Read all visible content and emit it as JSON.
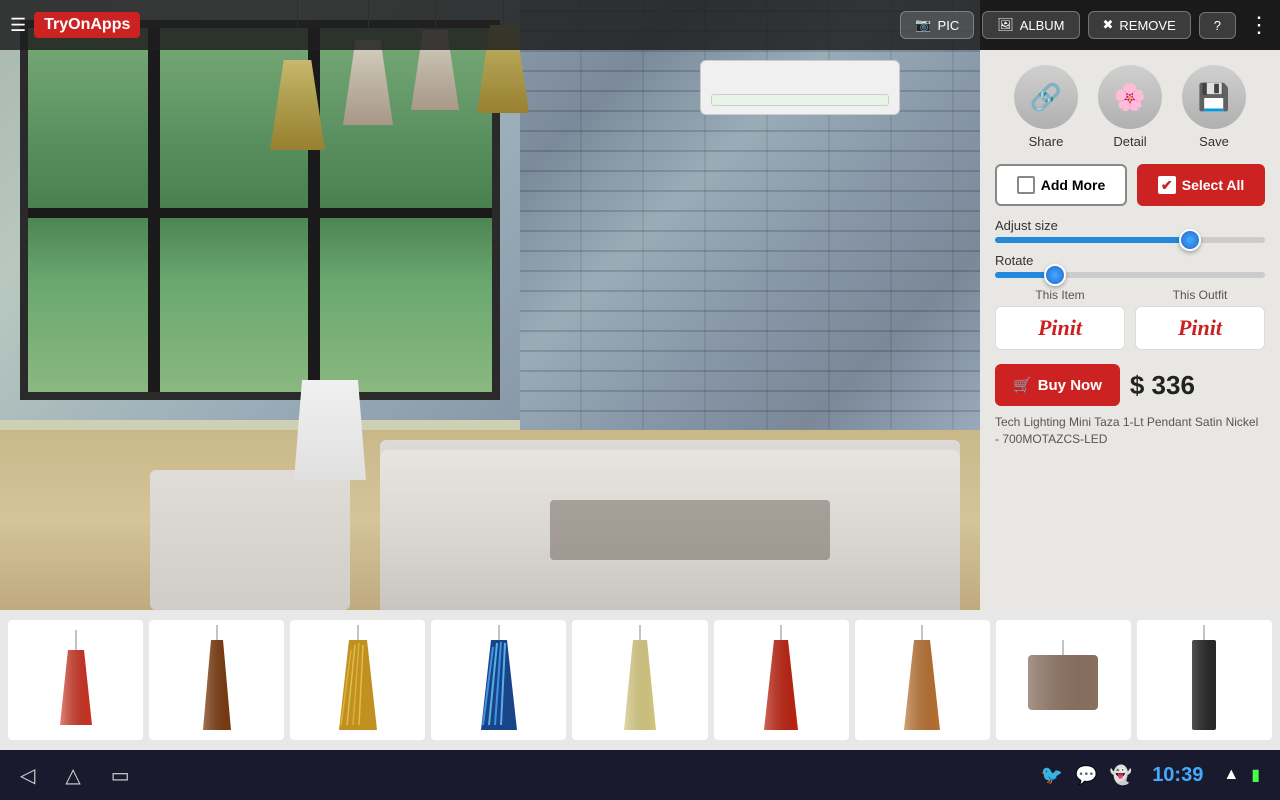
{
  "app": {
    "name": "TryOnApps"
  },
  "toolbar": {
    "hamburger": "☰",
    "pic_label": "PIC",
    "album_label": "ALBUM",
    "remove_label": "REMOVE",
    "help_label": "?",
    "more_label": "⋮"
  },
  "panel": {
    "share_label": "Share",
    "detail_label": "Detail",
    "save_label": "Save",
    "add_more_label": "Add More",
    "select_all_label": "Select All",
    "adjust_size_label": "Adjust size",
    "rotate_label": "Rotate",
    "this_item_label": "This Item",
    "this_outfit_label": "This Outfit",
    "pinit_text": "Pinit",
    "buy_now_label": "Buy Now",
    "price": "$ 336",
    "product_name": "Tech Lighting Mini Taza 1-Lt Pendant Satin Nickel - 700MOTAZCS-LED",
    "adjust_size_pct": 70,
    "rotate_pct": 30
  },
  "status_bar": {
    "back_icon": "◁",
    "home_icon": "△",
    "recent_icon": "▭",
    "twitter_icon": "🐦",
    "chat_icon": "💬",
    "ghost_icon": "👻",
    "time": "10:39",
    "wifi_icon": "▲",
    "battery_icon": "▮"
  },
  "thumbnails": [
    {
      "id": 1,
      "color": "#cc3322",
      "shape": "cone-narrow",
      "label": "Red narrow"
    },
    {
      "id": 2,
      "color": "#8b4513",
      "shape": "cone-tall",
      "label": "Brown tall"
    },
    {
      "id": 3,
      "color": "#d4a830",
      "shape": "cone-med",
      "label": "Gold cone"
    },
    {
      "id": 4,
      "color": "#2266aa",
      "shape": "cone-stripe",
      "label": "Blue stripe"
    },
    {
      "id": 5,
      "color": "#d4c070",
      "shape": "cone-plain",
      "label": "Beige cone"
    },
    {
      "id": 6,
      "color": "#cc3322",
      "shape": "cone-red2",
      "label": "Red cone"
    },
    {
      "id": 7,
      "color": "#b87030",
      "shape": "cone-amber",
      "label": "Amber cone"
    },
    {
      "id": 8,
      "color": "#8a7060",
      "shape": "drum",
      "label": "Drum shade"
    },
    {
      "id": 9,
      "color": "#303030",
      "shape": "cylinder",
      "label": "Dark cylinder"
    }
  ]
}
